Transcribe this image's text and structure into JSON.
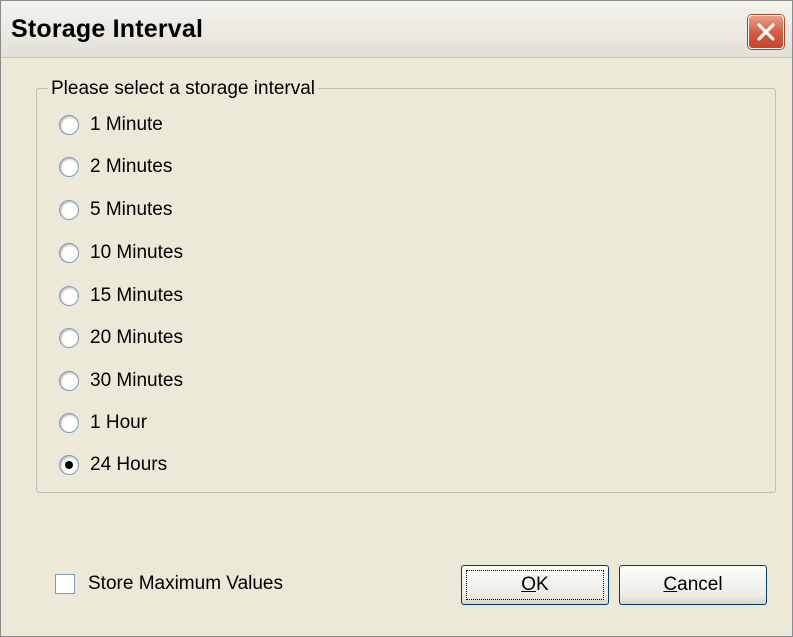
{
  "window": {
    "title": "Storage Interval"
  },
  "group": {
    "legend": "Please select a storage interval",
    "options": [
      {
        "label": "1 Minute",
        "checked": false
      },
      {
        "label": "2 Minutes",
        "checked": false
      },
      {
        "label": "5 Minutes",
        "checked": false
      },
      {
        "label": "10 Minutes",
        "checked": false
      },
      {
        "label": "15 Minutes",
        "checked": false
      },
      {
        "label": "20 Minutes",
        "checked": false
      },
      {
        "label": "30 Minutes",
        "checked": false
      },
      {
        "label": "1 Hour",
        "checked": false
      },
      {
        "label": "24 Hours",
        "checked": true
      }
    ]
  },
  "store_max": {
    "label": "Store Maximum Values",
    "checked": false
  },
  "buttons": {
    "ok_mnemonic": "O",
    "ok_rest": "K",
    "cancel_mnemonic": "C",
    "cancel_rest": "ancel"
  },
  "colors": {
    "dialog_bg": "#ece9d8",
    "close_button": "#d7573d"
  }
}
